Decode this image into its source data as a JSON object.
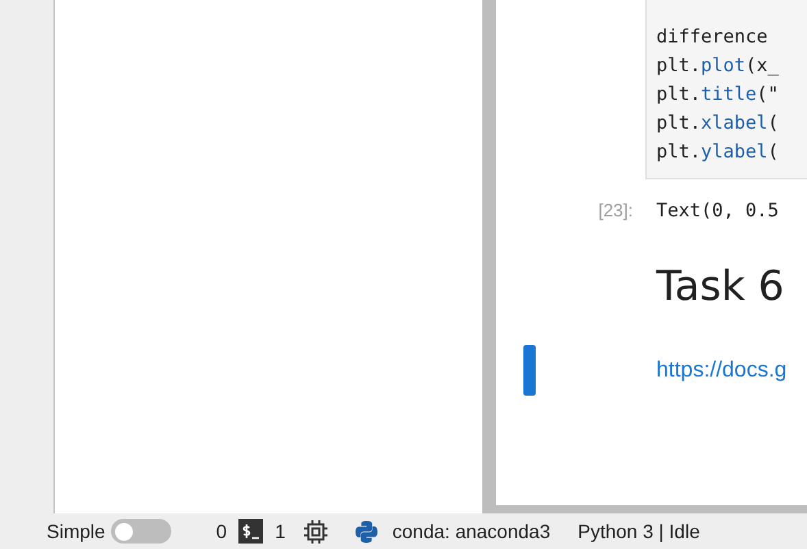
{
  "cells": [
    {
      "kind": "code",
      "selected": false,
      "lines": [
        [
          {
            "text": "difference",
            "kind": "plain"
          }
        ],
        [
          {
            "text": "plt.",
            "kind": "plain"
          },
          {
            "text": "plot",
            "kind": "function"
          },
          {
            "text": "(x_",
            "kind": "plain"
          }
        ],
        [
          {
            "text": "plt.",
            "kind": "plain"
          },
          {
            "text": "title",
            "kind": "function"
          },
          {
            "text": "(\"",
            "kind": "plain"
          }
        ],
        [
          {
            "text": "plt.",
            "kind": "plain"
          },
          {
            "text": "xlabel",
            "kind": "function"
          },
          {
            "text": "(",
            "kind": "plain"
          }
        ],
        [
          {
            "text": "plt.",
            "kind": "plain"
          },
          {
            "text": "ylabel",
            "kind": "function"
          },
          {
            "text": "(",
            "kind": "plain"
          }
        ]
      ],
      "output": {
        "prompt": "[23]:",
        "text": "Text(0, 0.5"
      }
    },
    {
      "kind": "heading",
      "selected": false,
      "text": "Task 6"
    },
    {
      "kind": "link",
      "selected": true,
      "text": "https://docs.g"
    }
  ],
  "status_bar": {
    "mode": {
      "label": "Simple",
      "on": false
    },
    "terminals": "0",
    "kernels": "1",
    "environment": "conda: anaconda3",
    "kernel_status": "Python 3 | Idle"
  }
}
